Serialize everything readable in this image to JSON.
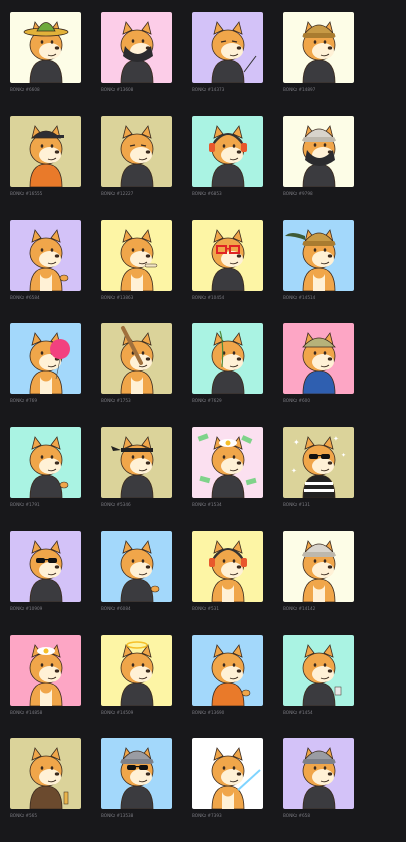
{
  "cards": [
    {
      "label": "BONKz #6608",
      "bg": "#fdfde7",
      "hat": "sombrero",
      "face": "plain",
      "outfit": "dark",
      "prop": "none"
    },
    {
      "label": "BONKz #13608",
      "bg": "#fccde8",
      "hat": "none",
      "face": "mask",
      "outfit": "dark",
      "prop": "none"
    },
    {
      "label": "BONKz #14373",
      "bg": "#d3c2f8",
      "hat": "none",
      "face": "wink",
      "outfit": "dark",
      "prop": "stick"
    },
    {
      "label": "BONKz #14897",
      "bg": "#fdfde7",
      "hat": "beanie",
      "face": "plain",
      "outfit": "dark",
      "prop": "none"
    },
    {
      "label": "BONKz #16555",
      "bg": "#dbd39a",
      "hat": "cap",
      "face": "plain",
      "outfit": "orange",
      "prop": "none"
    },
    {
      "label": "BONKz #12227",
      "bg": "#dbd39a",
      "hat": "none",
      "face": "angry",
      "outfit": "dark",
      "prop": "none"
    },
    {
      "label": "BONKz #6853",
      "bg": "#aaf3e3",
      "hat": "headphones",
      "face": "plain",
      "outfit": "dark",
      "prop": "none"
    },
    {
      "label": "BONKz #9798",
      "bg": "#fdfde7",
      "hat": "beanie-white",
      "face": "mask",
      "outfit": "dark",
      "prop": "none"
    },
    {
      "label": "BONKz #6584",
      "bg": "#d3c2f8",
      "hat": "none",
      "face": "plain",
      "outfit": "none",
      "prop": "paw"
    },
    {
      "label": "BONKz #13863",
      "bg": "#fdf5a5",
      "hat": "none",
      "face": "plain",
      "outfit": "none",
      "prop": "bone"
    },
    {
      "label": "BONKz #10454",
      "bg": "#fdf5a5",
      "hat": "none",
      "face": "glasses-red",
      "outfit": "dark",
      "prop": "none"
    },
    {
      "label": "BONKz #14514",
      "bg": "#a3d8fb",
      "hat": "beanie-feather",
      "face": "plain",
      "outfit": "none",
      "prop": "none"
    },
    {
      "label": "BONKz #769",
      "bg": "#a3d8fb",
      "hat": "none",
      "face": "plain",
      "outfit": "none",
      "prop": "balloon"
    },
    {
      "label": "BONKz #1753",
      "bg": "#dbd39a",
      "hat": "none",
      "face": "plain",
      "outfit": "none",
      "prop": "bat"
    },
    {
      "label": "BONKz #7629",
      "bg": "#aaf3e3",
      "hat": "none",
      "face": "plain",
      "outfit": "dark",
      "prop": "twig"
    },
    {
      "label": "BONKz #600",
      "bg": "#fda6c5",
      "hat": "helmet",
      "face": "plain",
      "outfit": "blue",
      "prop": "none"
    },
    {
      "label": "BONKz #1791",
      "bg": "#aaf3e3",
      "hat": "none",
      "face": "plain",
      "outfit": "dark",
      "prop": "paw"
    },
    {
      "label": "BONKz #5346",
      "bg": "#dbd39a",
      "hat": "ninja",
      "face": "plain",
      "outfit": "dark",
      "prop": "none"
    },
    {
      "label": "BONKz #1534",
      "bg": "#fbe0f0",
      "hat": "egg",
      "face": "plain",
      "outfit": "dark",
      "prop": "money"
    },
    {
      "label": "BONKz #131",
      "bg": "#dbd39a",
      "hat": "none",
      "face": "sunglasses",
      "outfit": "stripes",
      "prop": "sparkles"
    },
    {
      "label": "BONKz #10909",
      "bg": "#d3c2f8",
      "hat": "none",
      "face": "sunglasses",
      "outfit": "dark",
      "prop": "none"
    },
    {
      "label": "BONKz #6084",
      "bg": "#a3d8fb",
      "hat": "none",
      "face": "plain",
      "outfit": "dark",
      "prop": "paw"
    },
    {
      "label": "BONKz #531",
      "bg": "#fdf5a5",
      "hat": "headphones",
      "face": "plain",
      "outfit": "none",
      "prop": "none"
    },
    {
      "label": "BONKz #14142",
      "bg": "#fdfde7",
      "hat": "beanie-white",
      "face": "plain",
      "outfit": "none",
      "prop": "none"
    },
    {
      "label": "BONKz #14858",
      "bg": "#fda6c5",
      "hat": "egg",
      "face": "plain",
      "outfit": "none",
      "prop": "none"
    },
    {
      "label": "BONKz #14509",
      "bg": "#fdf5a5",
      "hat": "halo",
      "face": "plain",
      "outfit": "dark",
      "prop": "none"
    },
    {
      "label": "BONKz #13690",
      "bg": "#a3d8fb",
      "hat": "none",
      "face": "plain",
      "outfit": "orange",
      "prop": "paw"
    },
    {
      "label": "BONKz #1454",
      "bg": "#aaf3e3",
      "hat": "none",
      "face": "plain",
      "outfit": "dark",
      "prop": "cup"
    },
    {
      "label": "BONKz #565",
      "bg": "#dbd39a",
      "hat": "none",
      "face": "plain",
      "outfit": "brown",
      "prop": "bottle"
    },
    {
      "label": "BONKz #13538",
      "bg": "#a3d8fb",
      "hat": "beanie-grey",
      "face": "sunglasses",
      "outfit": "dark",
      "prop": "none"
    },
    {
      "label": "BONKz #7393",
      "bg": "#ffffff",
      "hat": "none",
      "face": "plain",
      "outfit": "none",
      "prop": "saber"
    },
    {
      "label": "BONKz #658",
      "bg": "#d3c2f8",
      "hat": "beanie-grey",
      "face": "plain",
      "outfit": "dark",
      "prop": "none"
    }
  ]
}
